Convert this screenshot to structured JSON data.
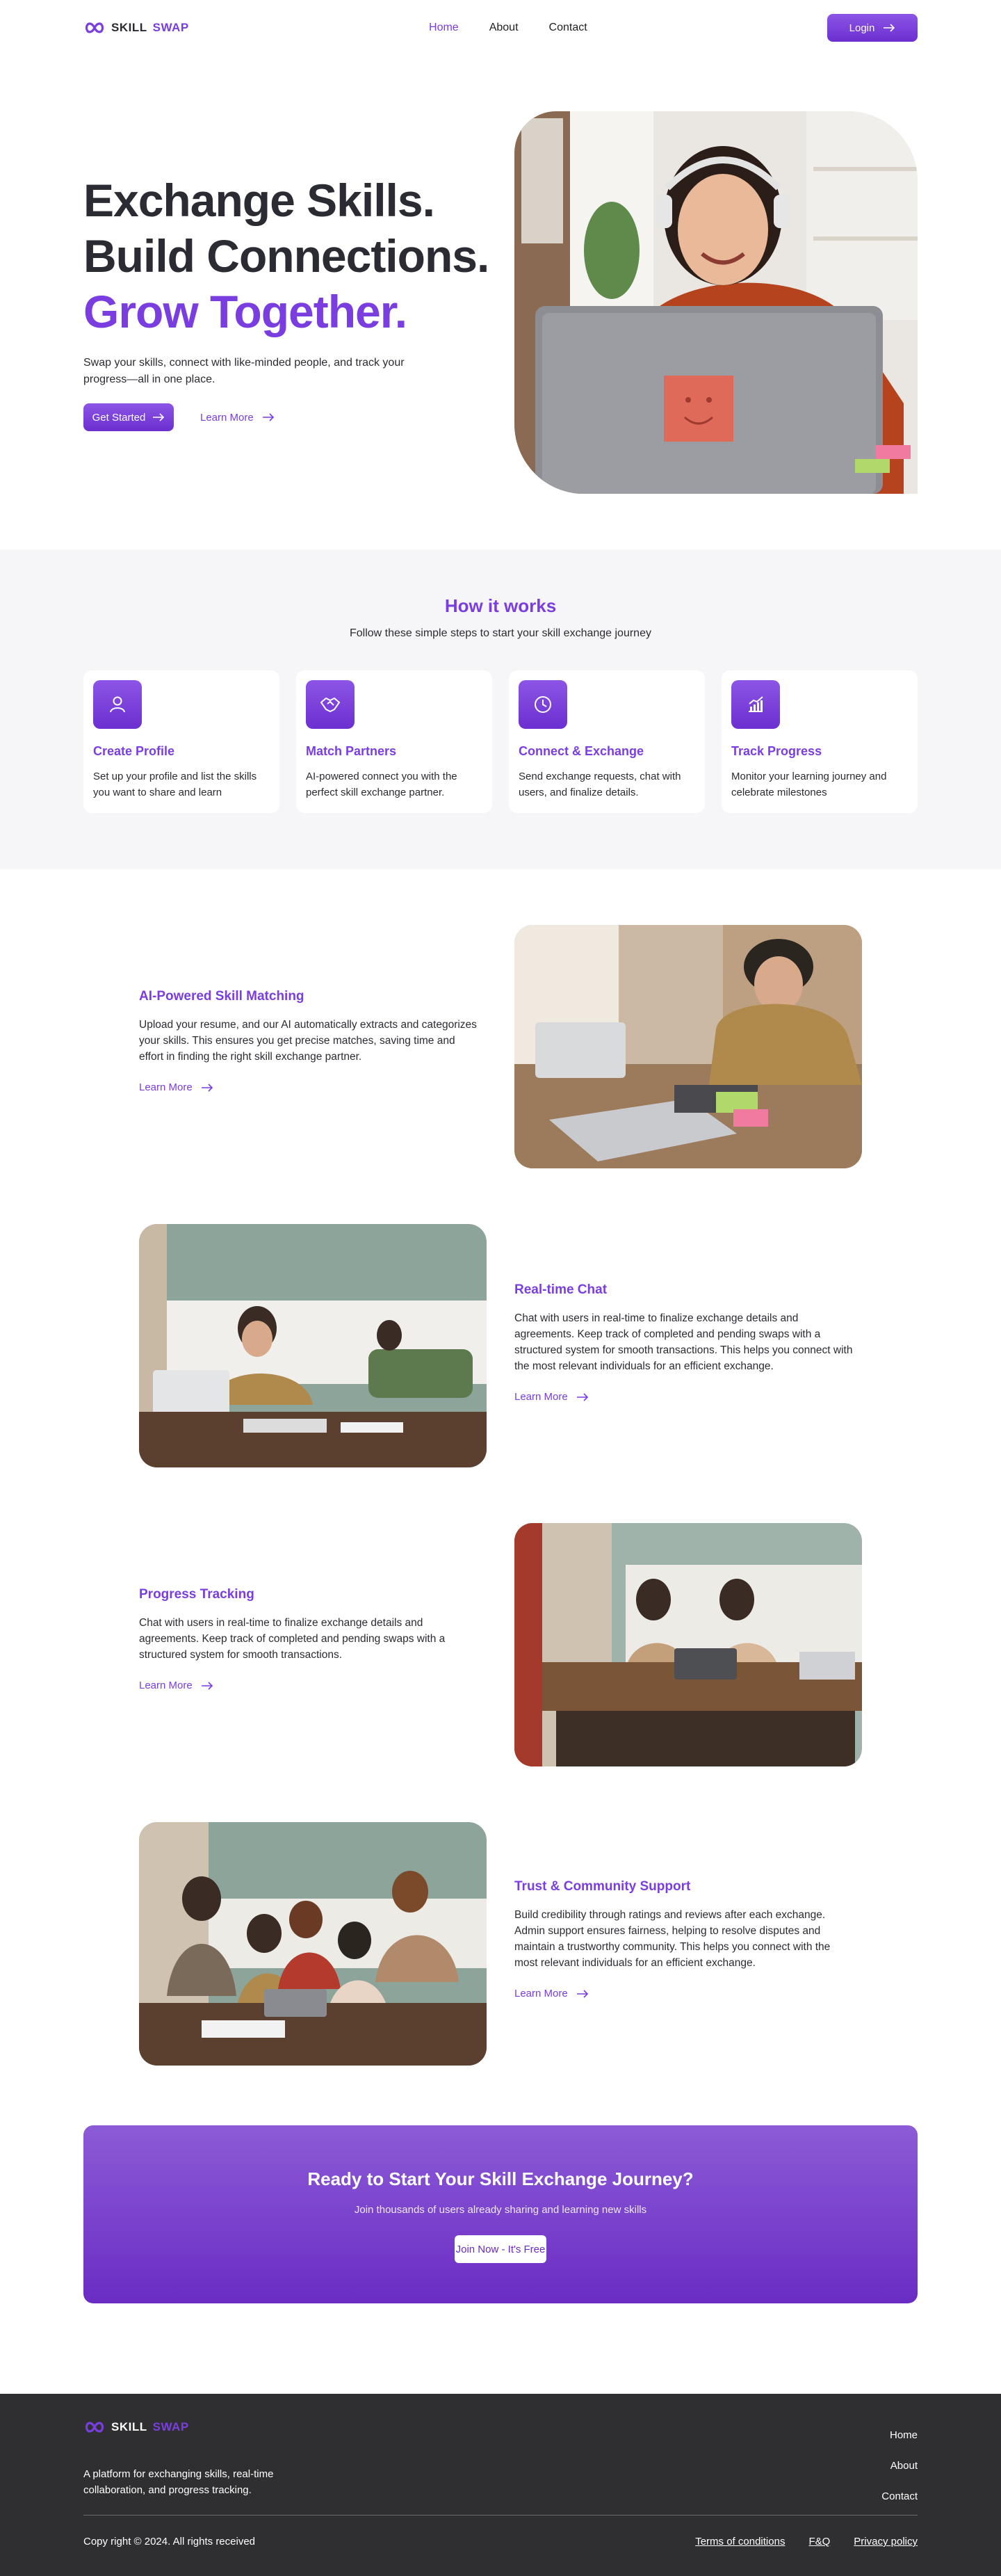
{
  "brand": {
    "word1": "SKILL",
    "word2": "SWAP",
    "accent": "#7a3ee0"
  },
  "nav": {
    "links": [
      "Home",
      "About",
      "Contact"
    ],
    "login_label": "Login"
  },
  "hero": {
    "line1": "Exchange Skills.",
    "line2": "Build Connections.",
    "line3": "Grow Together.",
    "subtitle": "Swap your skills, connect with like-minded people, and track your progress—all in one place.",
    "cta_primary": "Get Started",
    "cta_secondary": "Learn More"
  },
  "how": {
    "title": "How it works",
    "subtitle": "Follow these simple steps to start your skill exchange journey",
    "cards": [
      {
        "icon": "user-icon",
        "title": "Create Profile",
        "text": "Set up your profile and list the skills you want to share and learn"
      },
      {
        "icon": "handshake-icon",
        "title": "Match Partners",
        "text": "AI-powered connect you with the perfect skill exchange partner."
      },
      {
        "icon": "clock-icon",
        "title": "Connect & Exchange",
        "text": "Send exchange requests, chat with users, and finalize details."
      },
      {
        "icon": "chart-icon",
        "title": "Track Progress",
        "text": "Monitor your learning journey and celebrate milestones"
      }
    ]
  },
  "features": [
    {
      "title": "AI-Powered Skill Matching",
      "text": "Upload your resume, and our AI automatically extracts and categorizes your skills. This ensures you get precise matches, saving time and effort in finding the right skill exchange partner.",
      "learn": "Learn More"
    },
    {
      "title": "Real-time Chat",
      "text": "Chat with users in real-time to finalize exchange details and agreements. Keep track of completed and pending swaps with a structured system for smooth transactions. This helps you connect with the most relevant individuals for an efficient exchange.",
      "learn": "Learn More"
    },
    {
      "title": "Progress Tracking",
      "text": "Chat with users in real-time to finalize exchange details and agreements. Keep track of completed and pending swaps with a structured system for smooth transactions.",
      "learn": "Learn More"
    },
    {
      "title": "Trust & Community Support",
      "text": "Build credibility through ratings and reviews after each exchange. Admin support ensures fairness, helping to resolve disputes and maintain a trustworthy community. This helps you connect with the most relevant individuals for an efficient exchange.",
      "learn": "Learn More"
    }
  ],
  "cta": {
    "title": "Ready to Start Your Skill Exchange Journey?",
    "subtitle": "Join thousands of users already sharing and learning new skills",
    "button": "Join Now - It's Free"
  },
  "footer": {
    "description": "A platform for exchanging skills, real-time collaboration, and progress tracking.",
    "links": [
      "Home",
      "About",
      "Contact"
    ],
    "copyright": "Copy right © 2024. All rights received",
    "legal": [
      "Terms of conditions",
      "F&Q",
      "Privacy policy"
    ]
  }
}
